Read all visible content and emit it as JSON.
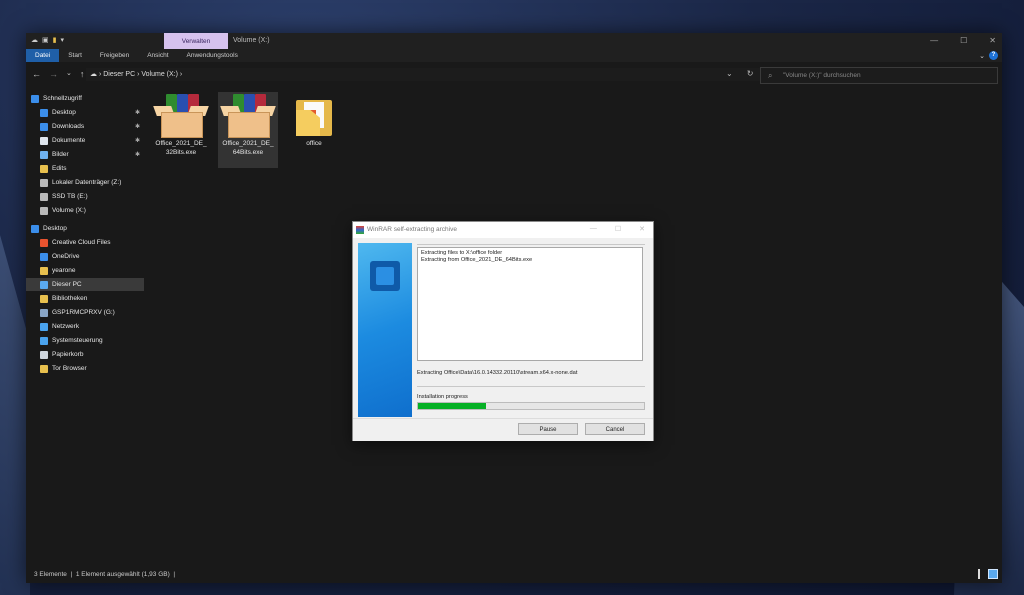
{
  "window": {
    "ribbon_context_tab": "Verwalten",
    "title": "Volume (X:)",
    "controls": [
      "—",
      "☐",
      "✕"
    ]
  },
  "ribbon": {
    "tabs": [
      "Datei",
      "Start",
      "Freigeben",
      "Ansicht",
      "Anwendungstools"
    ],
    "active_tab": "Datei"
  },
  "address": {
    "path": [
      "Dieser PC",
      "Volume (X:)"
    ],
    "search_placeholder": "\"Volume (X:)\" durchsuchen"
  },
  "nav": {
    "items": [
      {
        "label": "Schnellzugriff",
        "icon": "star-icon",
        "color": "#3b8eea"
      },
      {
        "label": "Desktop",
        "icon": "desktop-icon",
        "color": "#3b8eea",
        "pinned": true
      },
      {
        "label": "Downloads",
        "icon": "download-icon",
        "color": "#3b8eea",
        "pinned": true
      },
      {
        "label": "Dokumente",
        "icon": "document-icon",
        "color": "#dfe6ee",
        "pinned": true
      },
      {
        "label": "Bilder",
        "icon": "pictures-icon",
        "color": "#6fb2f0",
        "pinned": true
      },
      {
        "label": "Edits",
        "icon": "folder-icon",
        "color": "#e8c04e"
      },
      {
        "label": "Lokaler Datenträger (Z:)",
        "icon": "drive-icon",
        "color": "#b9b9b9"
      },
      {
        "label": "SSD TB (E:)",
        "icon": "drive-icon",
        "color": "#b9b9b9"
      },
      {
        "label": "Volume (X:)",
        "icon": "drive-icon",
        "color": "#b9b9b9"
      },
      {
        "label": "Desktop",
        "icon": "desktop-icon",
        "color": "#3b8eea"
      },
      {
        "label": "Creative Cloud Files",
        "icon": "creative-cloud-icon",
        "color": "#e8532f"
      },
      {
        "label": "OneDrive",
        "icon": "cloud-icon",
        "color": "#3b8eea"
      },
      {
        "label": "yearone",
        "icon": "user-folder-icon",
        "color": "#e8c04e"
      },
      {
        "label": "Dieser PC",
        "icon": "computer-icon",
        "color": "#5aa9ee"
      },
      {
        "label": "Bibliotheken",
        "icon": "library-icon",
        "color": "#e8c04e"
      },
      {
        "label": "GSP1RMCPRXV (G:)",
        "icon": "network-drive-icon",
        "color": "#8aa6c6"
      },
      {
        "label": "Netzwerk",
        "icon": "network-icon",
        "color": "#4aa3ee"
      },
      {
        "label": "Systemsteuerung",
        "icon": "control-panel-icon",
        "color": "#4aa3ee"
      },
      {
        "label": "Papierkorb",
        "icon": "recycle-bin-icon",
        "color": "#cfd6de"
      },
      {
        "label": "Tor Browser",
        "icon": "folder-icon",
        "color": "#e8c04e"
      }
    ]
  },
  "files": [
    {
      "name": "Office_2021_DE_ 32Bits.exe",
      "icon": "winrar-archive-icon"
    },
    {
      "name": "Office_2021_DE_ 64Bits.exe",
      "icon": "winrar-archive-icon",
      "selected": true
    },
    {
      "name": "office",
      "icon": "folder-icon"
    }
  ],
  "status": {
    "count": "3 Elemente",
    "selection": "1 Element ausgewählt (1,93 GB)"
  },
  "dialog": {
    "title": "WinRAR self-extracting archive",
    "log_lines": [
      "Extracting files to X:\\office folder",
      "Extracting from Office_2021_DE_64Bits.exe"
    ],
    "current_file": "Extracting Office\\Data\\16.0.14332.20110\\stream.x64.x-none.dat",
    "progress_label": "Installation progress",
    "progress": 0.3,
    "pause_label": "Pause",
    "cancel_label": "Cancel"
  },
  "colors": {
    "accent": "#1f5fa8",
    "progress": "#06b025",
    "context_tab": "#d6c2ee"
  }
}
